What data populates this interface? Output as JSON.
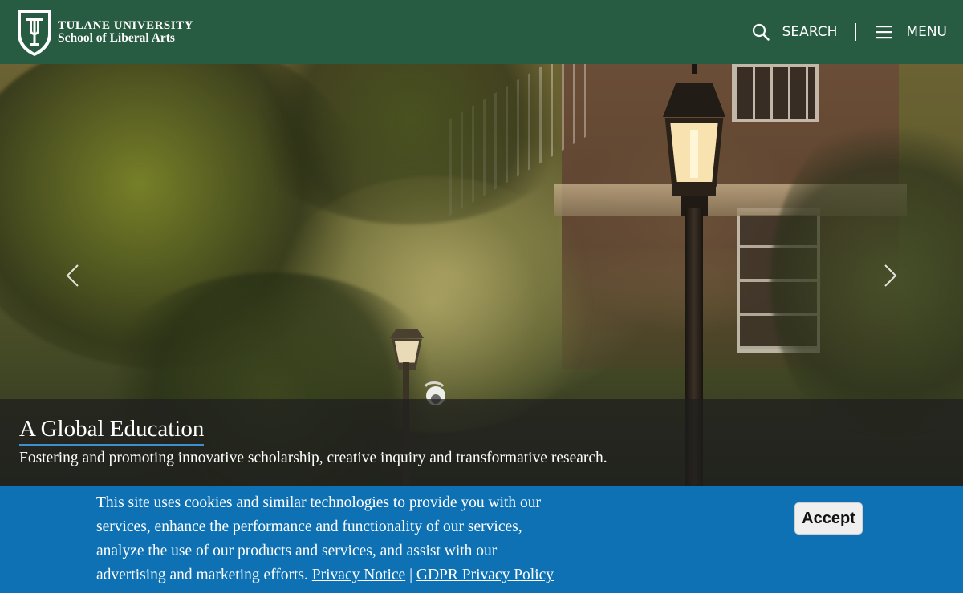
{
  "header": {
    "logo_line1": "TULANE UNIVERSITY",
    "logo_line2": "School of Liberal Arts",
    "search_label": "SEARCH",
    "menu_label": "MENU",
    "background_color": "#285c42"
  },
  "hero": {
    "title": "A Global Education",
    "subtitle": "Fostering and promoting innovative scholarship, creative inquiry and transformative research."
  },
  "cookie_banner": {
    "text": "This site uses cookies and similar technologies to provide you with our services, enhance the performance and functionality of our services, analyze the use of our products and services, and assist with our advertising and marketing efforts.",
    "privacy_link": "Privacy Notice",
    "separator": "|",
    "gdpr_link": "GDPR Privacy Policy",
    "accept_label": "Accept",
    "background_color": "#0e71b3"
  },
  "icons": {
    "logo": "tulane-shield-icon",
    "search": "search-icon",
    "menu": "hamburger-menu-icon",
    "prev": "chevron-left-icon",
    "next": "chevron-right-icon"
  }
}
